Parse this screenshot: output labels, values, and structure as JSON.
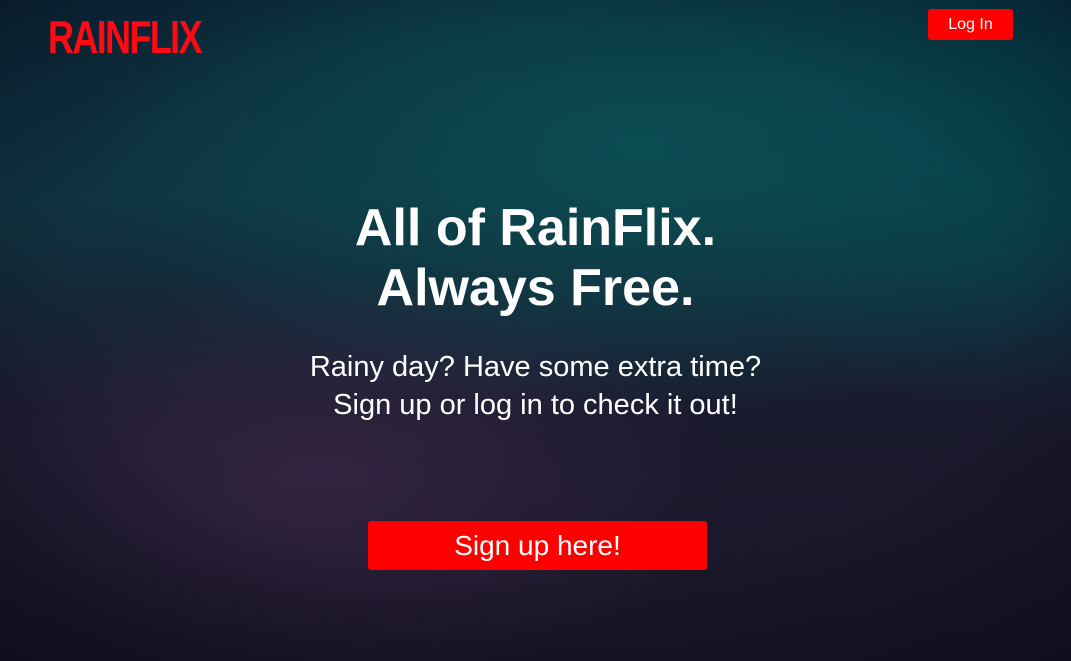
{
  "header": {
    "logo_text": "RAINFLIX",
    "login_label": "Log In"
  },
  "hero": {
    "headline_line1": "All of RainFlix.",
    "headline_line2": "Always Free.",
    "subtext": "Rainy day? Have some extra time? Sign up or log in to check it out!",
    "signup_label": "Sign up here!"
  },
  "colors": {
    "brand_red": "#ff0a14",
    "button_red": "#ff0000",
    "text": "#ffffff"
  }
}
